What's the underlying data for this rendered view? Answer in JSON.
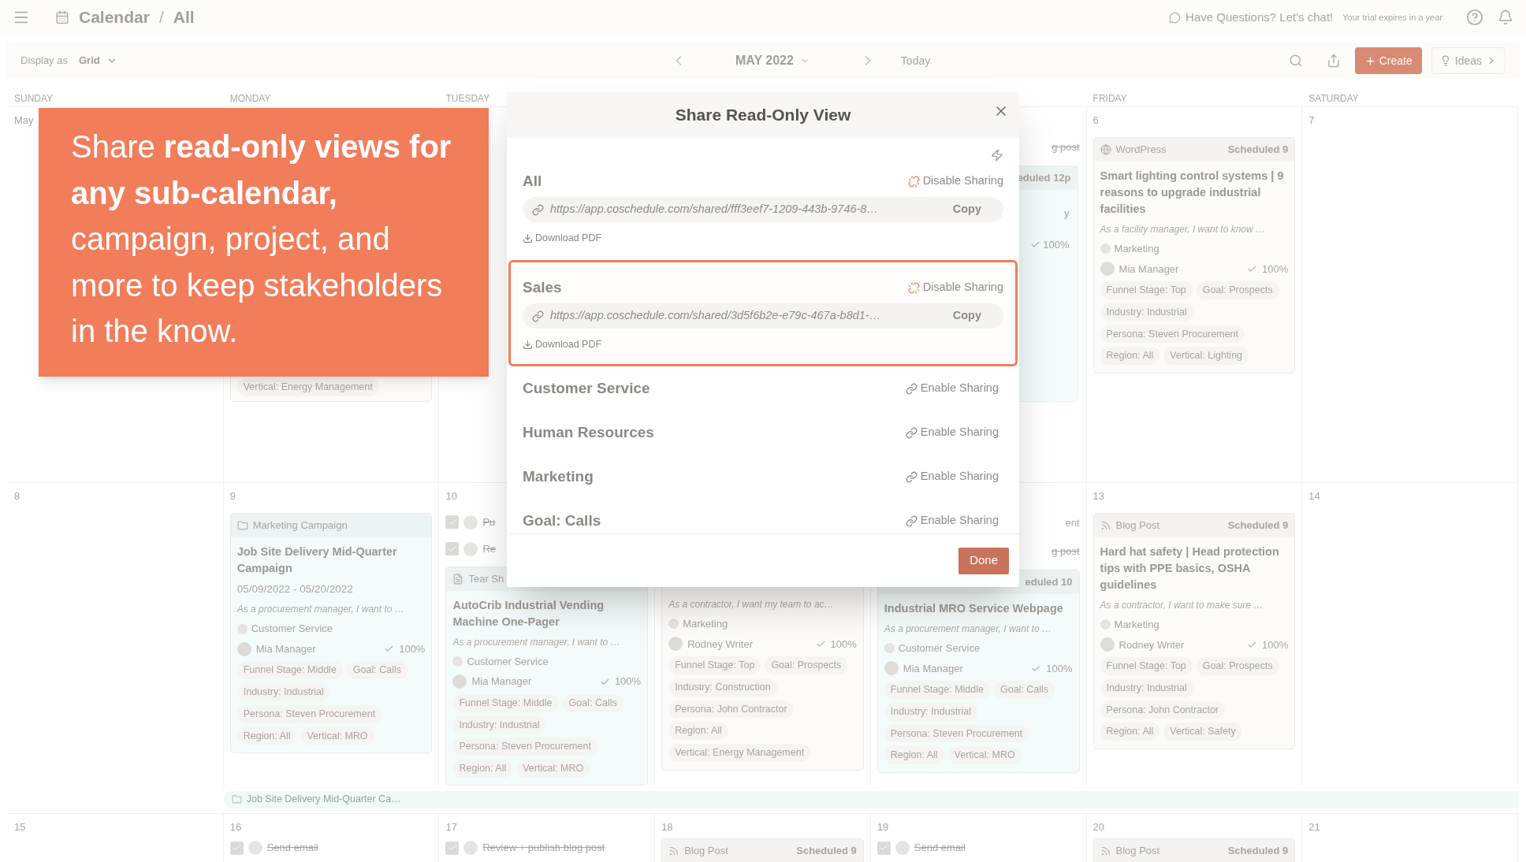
{
  "top_bar": {
    "title": "Calendar",
    "separator": "/",
    "subtitle": "All",
    "chat": "Have Questions? Let's chat!",
    "trial": "Your trial expires in a year"
  },
  "toolbar": {
    "display_label": "Display as",
    "display_value": "Grid",
    "month": "MAY 2022",
    "today": "Today",
    "create": "Create",
    "ideas": "Ideas"
  },
  "day_headers": [
    {
      "label": "SUNDAY"
    },
    {
      "label": "MONDAY"
    },
    {
      "label": "TUESDAY"
    },
    {
      "label": "FRIDAY"
    },
    {
      "label": "SATURDAY"
    }
  ],
  "weeks": [
    [
      {
        "date": "May"
      },
      {
        "items": [
          {
            "kind": "card_tail",
            "color": "#fdfbf9",
            "tags": [
              "Vertical: Energy Management"
            ]
          }
        ]
      },
      {
        "items": [
          {
            "kind": "fragment",
            "text": "g post",
            "done": true
          },
          {
            "kind": "fragment_card",
            "color": "#f3fcfa",
            "status": "eduled 12p",
            "lines": [
              "y"
            ],
            "progress": "100%"
          }
        ]
      },
      {
        "date": "6",
        "items": [
          {
            "kind": "wordpress_card",
            "color": "#fdfbf9",
            "type_label": "WordPress",
            "status": "Scheduled 9",
            "title": "Smart lighting control systems | 9 reasons to upgrade industrial facilities",
            "summary": "As a facility manager, I want to know …",
            "team": "Marketing",
            "owner": "Mia Manager",
            "progress": "100%",
            "tags": [
              "Funnel Stage: Top",
              "Goal: Prospects",
              "Industry: Industrial",
              "Persona: Steven Procurement",
              "Region: All",
              "Vertical: Lighting"
            ]
          }
        ]
      },
      {
        "date": "7"
      }
    ],
    [
      {
        "date": "8"
      },
      {
        "date": "9",
        "items": [
          {
            "kind": "campaign_card",
            "color": "#f3fcfa",
            "type_label": "Marketing Campaign",
            "title": "Job Site Delivery Mid-Quarter Campaign",
            "date": "05/09/2022 - 05/20/2022",
            "summary": "As a procurement manager, I want to …",
            "team": "Customer Service",
            "owner": "Mia Manager",
            "progress": "100%",
            "tags": [
              "Funnel Stage: Middle",
              "Goal: Calls",
              "Industry: Industrial",
              "Persona: Steven Procurement",
              "Region: All",
              "Vertical: MRO"
            ]
          }
        ]
      },
      {
        "date": "10",
        "items": [
          {
            "kind": "task",
            "text": "Pu",
            "done": true
          },
          {
            "kind": "task",
            "text": "Re",
            "done": true
          },
          {
            "kind": "sheet_card",
            "color": "#f3fcfa",
            "type_label": "Tear Sh",
            "title": "AutoCrib Industrial Vending Machine One-Pager",
            "summary": "As a procurement manager, I want to …",
            "team": "Customer Service",
            "owner": "Mia Manager",
            "progress": "100%",
            "tags": [
              "Funnel Stage: Middle",
              "Goal: Calls",
              "Industry: Industrial",
              "Persona: Steven Procurement",
              "Region: All",
              "Vertical: MRO"
            ]
          }
        ]
      },
      {
        "items": [
          {
            "kind": "card",
            "color": "#fdfbf9",
            "summary": "As a contractor, I want my team to ac…",
            "team": "Marketing",
            "owner": "Rodney Writer",
            "progress": "100%",
            "tags": [
              "Funnel Stage: Top",
              "Goal: Prospects",
              "Industry: Construction",
              "Persona: John Contractor",
              "Region: All",
              "Vertical: Energy Management"
            ]
          }
        ]
      },
      {
        "items": [
          {
            "kind": "fragment",
            "text": "ent",
            "done": false
          },
          {
            "kind": "fragment",
            "text": "g post",
            "done": true
          },
          {
            "kind": "card",
            "color": "#f3fcfa",
            "status": "eduled 10",
            "title": "Industrial MRO Service Webpage",
            "summary": "As a procurement manager, I want to …",
            "team": "Customer Service",
            "owner": "Mia Manager",
            "progress": "100%",
            "tags": [
              "Funnel Stage: Middle",
              "Goal: Calls",
              "Industry: Industrial",
              "Persona: Steven Procurement",
              "Region: All",
              "Vertical: MRO"
            ]
          }
        ]
      },
      {
        "date": "13",
        "items": [
          {
            "kind": "blog_card",
            "color": "#fdfbf9",
            "type_label": "Blog Post",
            "status": "Scheduled 9",
            "title": "Hard hat safety | Head protection tips with PPE basics, OSHA guidelines",
            "summary": "As a contractor, I want to make sure …",
            "team": "Marketing",
            "owner": "Rodney Writer",
            "progress": "100%",
            "tags": [
              "Funnel Stage: Top",
              "Goal: Prospects",
              "Industry: Industrial",
              "Persona: John Contractor",
              "Region: All",
              "Vertical: Safety"
            ]
          }
        ]
      },
      {
        "date": "14"
      }
    ],
    [
      {
        "date": "15"
      },
      {
        "date": "16",
        "items": [
          {
            "kind": "task",
            "text": "Send email",
            "done": true
          }
        ]
      },
      {
        "date": "17",
        "items": [
          {
            "kind": "task",
            "text": "Review + publish blog post",
            "done": true
          }
        ]
      },
      {
        "date": "18",
        "items": [
          {
            "kind": "blog_head",
            "color": "#fdfbf9",
            "type_label": "Blog Post",
            "status": "Scheduled 9"
          }
        ]
      },
      {
        "date": "19",
        "items": [
          {
            "kind": "task",
            "text": "Send email",
            "done": true
          }
        ]
      },
      {
        "date": "20",
        "items": [
          {
            "kind": "blog_head",
            "color": "#fdfbf9",
            "type_label": "Blog Post",
            "status": "Scheduled 9"
          }
        ]
      },
      {
        "date": "21"
      }
    ]
  ],
  "campaign_band": {
    "label": "Job Site Delivery Mid-Quarter Ca…"
  },
  "callout": {
    "text": "Share **read-only views for any sub-calendar,** campaign, project, and more to keep stakeholders in the know."
  },
  "dialog": {
    "title": "Share Read-Only View",
    "done": "Done",
    "sections": [
      {
        "name": "All",
        "shared": true,
        "action": "Disable Sharing",
        "url": "https://app.coschedule.com/shared/fff3eef7-1209-443b-9746-8…",
        "copy": "Copy",
        "download": "Download PDF",
        "highlighted": false
      },
      {
        "name": "Sales",
        "shared": true,
        "action": "Disable Sharing",
        "url": "https://app.coschedule.com/shared/3d5f6b2e-e79c-467a-b8d1-…",
        "copy": "Copy",
        "download": "Download PDF",
        "highlighted": true
      },
      {
        "name": "Customer Service",
        "shared": false,
        "action": "Enable Sharing",
        "highlighted": false
      },
      {
        "name": "Human Resources",
        "shared": false,
        "action": "Enable Sharing",
        "highlighted": false
      },
      {
        "name": "Marketing",
        "shared": false,
        "action": "Enable Sharing",
        "highlighted": false
      },
      {
        "name": "Goal: Calls",
        "shared": false,
        "action": "Enable Sharing",
        "highlighted": false
      }
    ]
  }
}
